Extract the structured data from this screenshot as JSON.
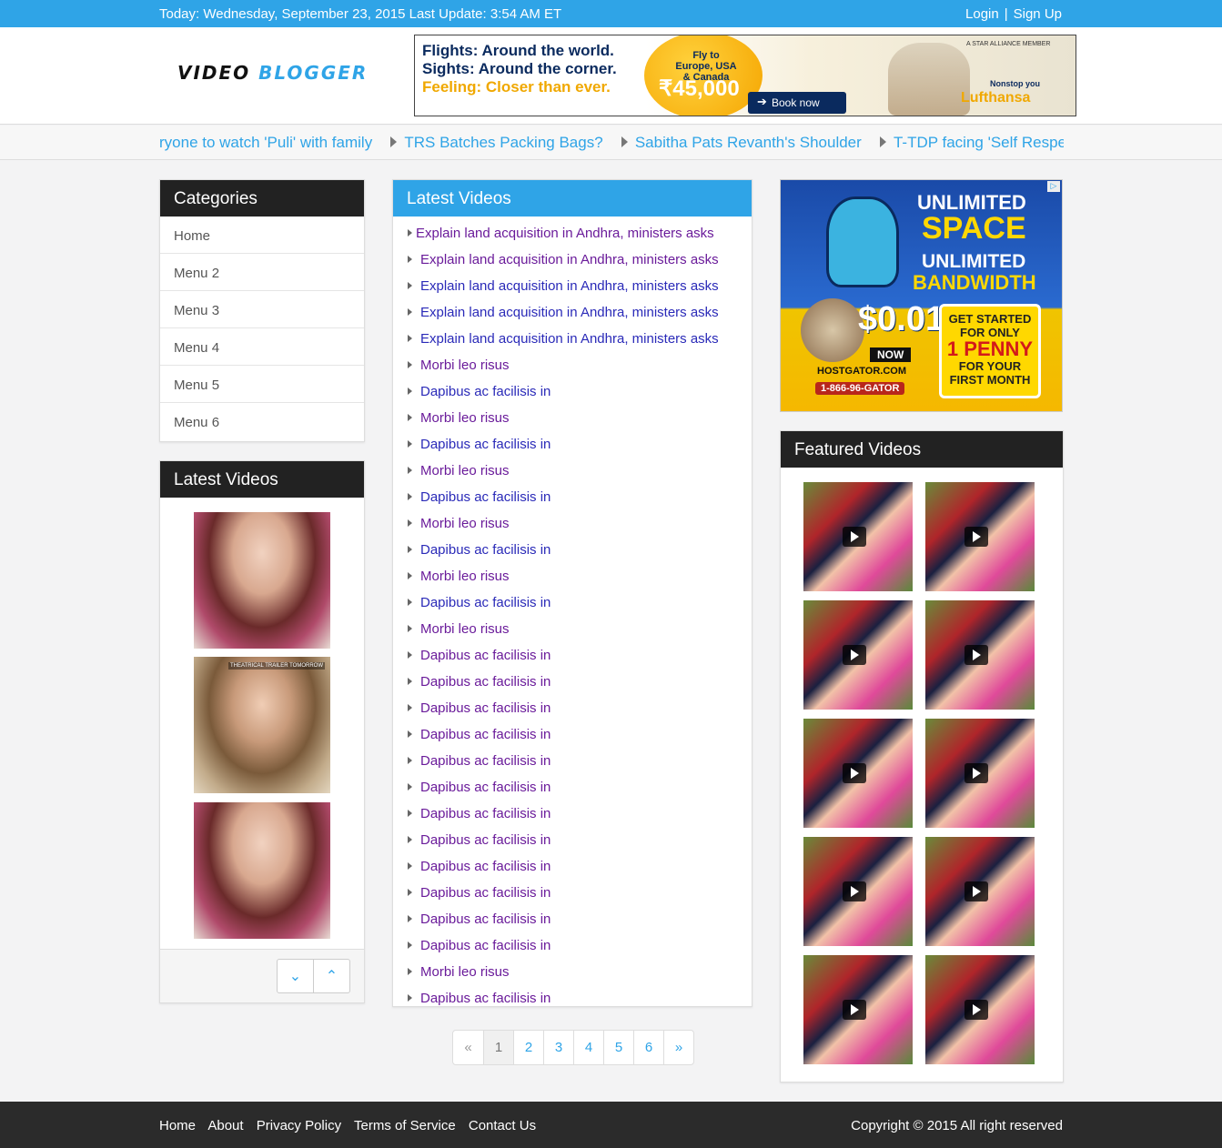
{
  "topbar": {
    "date_text": "Today: Wednesday, September 23, 2015 Last Update: 3:54 AM ET",
    "login": "Login",
    "separator": "|",
    "signup": "Sign Up"
  },
  "logo": {
    "part1": "VIDEO",
    "part2": "BLOGGER"
  },
  "banner_ad": {
    "line1": "Flights: Around the world.",
    "line2": "Sights: Around the corner.",
    "line3": "Feeling: Closer than ever.",
    "offer": "Fly to Europe, USA & Canada",
    "price": "₹45,000",
    "cta": "Book now",
    "alliance": "A STAR ALLIANCE MEMBER",
    "tagline": "Nonstop you",
    "brand": "Lufthansa"
  },
  "ticker": {
    "items": [
      "ryone to watch 'Puli' with family",
      "TRS Batches Packing Bags?",
      "Sabitha Pats Revanth's Shoulder",
      "T-TDP facing 'Self Respec"
    ]
  },
  "categories": {
    "title": "Categories",
    "items": [
      "Home",
      "Menu 2",
      "Menu 3",
      "Menu 4",
      "Menu 5",
      "Menu 6"
    ]
  },
  "sidebar_videos": {
    "title": "Latest Videos",
    "thumb_tag": "THEATRICAL TRAILER TOMORROW"
  },
  "latest_videos": {
    "title": "Latest Videos",
    "items": [
      "Explain land acquisition in Andhra, ministers asks",
      "Explain land acquisition in Andhra, ministers asks",
      "Explain land acquisition in Andhra, ministers asks",
      "Explain land acquisition in Andhra, ministers asks",
      "Explain land acquisition in Andhra, ministers asks",
      "Morbi leo risus",
      "Dapibus ac facilisis in",
      "Morbi leo risus",
      "Dapibus ac facilisis in",
      "Morbi leo risus",
      "Dapibus ac facilisis in",
      "Morbi leo risus",
      "Dapibus ac facilisis in",
      "Morbi leo risus",
      "Dapibus ac facilisis in",
      "Morbi leo risus",
      "Dapibus ac facilisis in",
      "Dapibus ac facilisis in",
      "Dapibus ac facilisis in",
      "Dapibus ac facilisis in",
      "Dapibus ac facilisis in",
      "Dapibus ac facilisis in",
      "Dapibus ac facilisis in",
      "Dapibus ac facilisis in",
      "Dapibus ac facilisis in",
      "Dapibus ac facilisis in",
      "Dapibus ac facilisis in",
      "Dapibus ac facilisis in",
      "Morbi leo risus",
      "Dapibus ac facilisis in"
    ]
  },
  "pagination": {
    "prev": "«",
    "pages": [
      "1",
      "2",
      "3",
      "4",
      "5",
      "6"
    ],
    "next": "»",
    "active": "1"
  },
  "side_ad": {
    "line1": "UNLIMITED",
    "line2": "SPACE",
    "line3": "UNLIMITED",
    "line4": "BANDWIDTH",
    "price": "$0.01",
    "now": "NOW",
    "host": "HOSTGATOR.COM",
    "phone": "1-866-96-GATOR",
    "box1": "GET STARTED FOR ONLY",
    "box2": "1 PENNY",
    "box3": "FOR YOUR FIRST MONTH"
  },
  "featured": {
    "title": "Featured Videos"
  },
  "footer": {
    "links": [
      "Home",
      "About",
      "Privacy Policy",
      "Terms of Service",
      "Contact Us"
    ],
    "copyright": "Copyright © 2015 All right reserved"
  },
  "colors": {
    "accent": "#2fa4e7",
    "dark": "#222222",
    "footer": "#2b2b2b"
  }
}
